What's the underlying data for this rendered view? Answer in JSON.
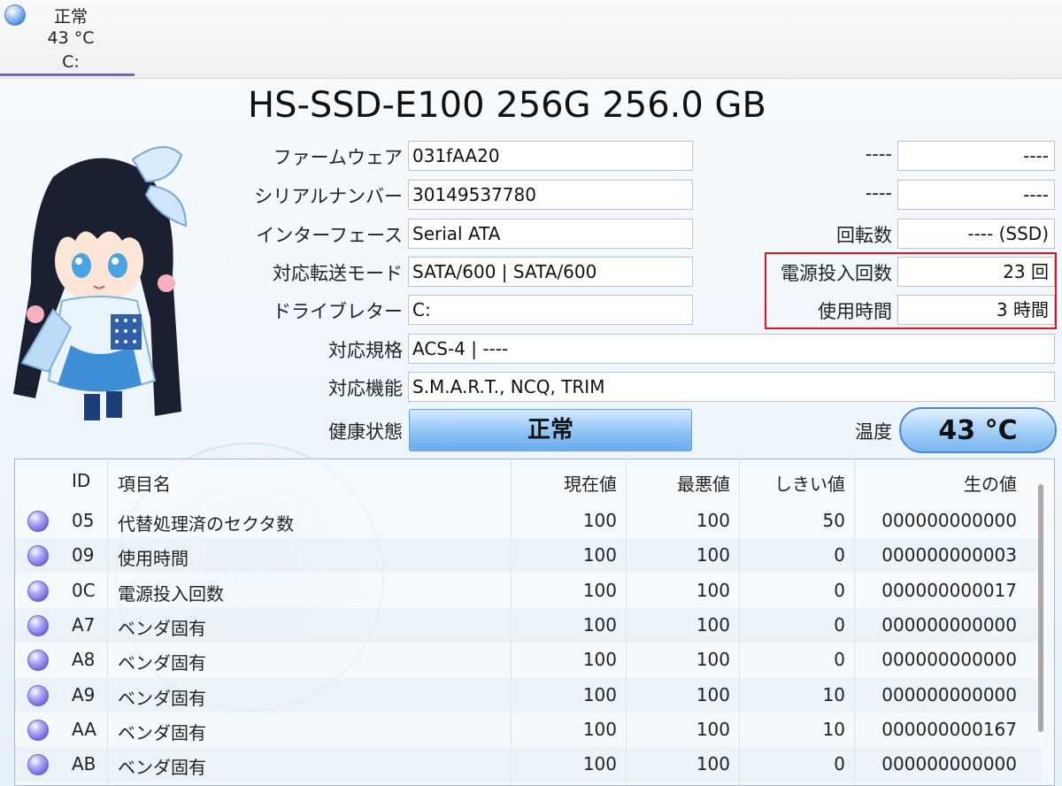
{
  "drive_tab": {
    "status": "正常",
    "temperature": "43 °C",
    "letter": "C:"
  },
  "title": "HS-SSD-E100 256G 256.0 GB",
  "info": {
    "firmware_label": "ファームウェア",
    "firmware": "031fAA20",
    "serial_label": "シリアルナンバー",
    "serial": "30149537780",
    "interface_label": "インターフェース",
    "interface": "Serial ATA",
    "transfer_label": "対応転送モード",
    "transfer": "SATA/600 | SATA/600",
    "drive_letter_label": "ドライブレター",
    "drive_letter": "C:",
    "standard_label": "対応規格",
    "standard": "ACS-4 | ----",
    "features_label": "対応機能",
    "features": "S.M.A.R.T., NCQ, TRIM",
    "health_label": "健康状態",
    "health": "正常",
    "temp_label": "温度",
    "temp": "43 °C"
  },
  "right_info": {
    "r1_label": "----",
    "r1_value": "----",
    "r2_label": "----",
    "r2_value": "----",
    "rotation_label": "回転数",
    "rotation": "---- (SSD)",
    "power_on_count_label": "電源投入回数",
    "power_on_count": "23 回",
    "power_on_hours_label": "使用時間",
    "power_on_hours": "3 時間"
  },
  "table": {
    "headers": {
      "id": "ID",
      "name": "項目名",
      "current": "現在値",
      "worst": "最悪値",
      "threshold": "しきい値",
      "raw": "生の値"
    },
    "rows": [
      {
        "id": "05",
        "name": "代替処理済のセクタ数",
        "current": "100",
        "worst": "100",
        "threshold": "50",
        "raw": "000000000000"
      },
      {
        "id": "09",
        "name": "使用時間",
        "current": "100",
        "worst": "100",
        "threshold": "0",
        "raw": "000000000003"
      },
      {
        "id": "0C",
        "name": "電源投入回数",
        "current": "100",
        "worst": "100",
        "threshold": "0",
        "raw": "000000000017"
      },
      {
        "id": "A7",
        "name": "ベンダ固有",
        "current": "100",
        "worst": "100",
        "threshold": "0",
        "raw": "000000000000"
      },
      {
        "id": "A8",
        "name": "ベンダ固有",
        "current": "100",
        "worst": "100",
        "threshold": "0",
        "raw": "000000000000"
      },
      {
        "id": "A9",
        "name": "ベンダ固有",
        "current": "100",
        "worst": "100",
        "threshold": "10",
        "raw": "000000000000"
      },
      {
        "id": "AA",
        "name": "ベンダ固有",
        "current": "100",
        "worst": "100",
        "threshold": "10",
        "raw": "000000000167"
      },
      {
        "id": "AB",
        "name": "ベンダ固有",
        "current": "100",
        "worst": "100",
        "threshold": "0",
        "raw": "000000000000"
      }
    ]
  },
  "colors": {
    "highlight_box": "#e0141e",
    "tab_underline": "#7b5cd6",
    "health_button": "#8ec3f4"
  },
  "icons": {
    "status": "status-orb-icon",
    "mascot": "mascot-illustration"
  }
}
